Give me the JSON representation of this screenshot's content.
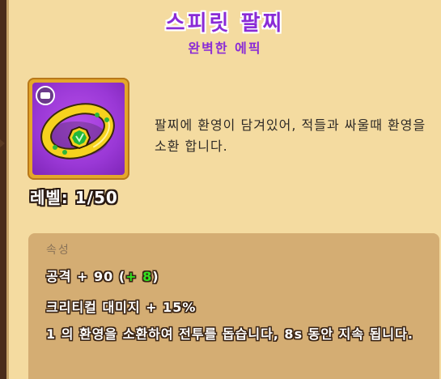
{
  "item": {
    "name": "스피릿 팔찌",
    "rarity": "완벽한 에픽",
    "level_label": "레벨: 1/50",
    "description": "팔찌에 환영이 담겨있어, 적들과 싸울때 환영을 소환 합니다.",
    "icon": "emerald-ring-icon",
    "badge_icon": "category-badge-icon"
  },
  "attributes": {
    "header": "속성",
    "attack_base": "공격 + 90 (",
    "attack_bonus": "+ 8",
    "attack_close": ")",
    "crit_damage": "크리티컬 대미지 + 15%",
    "skill": "1 의 환영을 소환하여 전투를 돕습니다, 8s 동안 지속 됩니다."
  },
  "colors": {
    "title": "#8a2bd6",
    "panel_bg": "#f4dba0",
    "item_bg": "#9a38d6",
    "frame": "#e4a72a",
    "bonus_text": "#34e020"
  }
}
